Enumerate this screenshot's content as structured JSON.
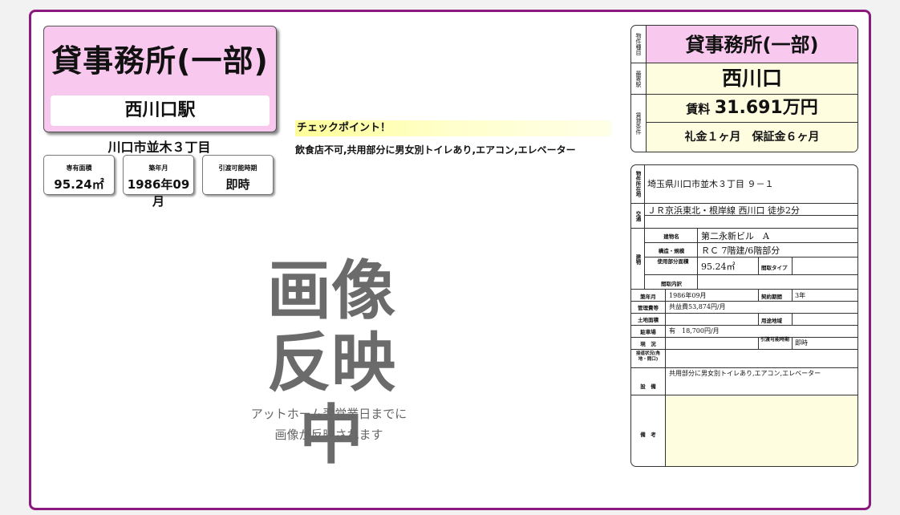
{
  "header": {
    "type": "貸事務所(一部)",
    "station": "西川口駅",
    "address": "川口市並木３丁目"
  },
  "mini_cards": [
    {
      "label": "専有面積",
      "value": "95.24㎡"
    },
    {
      "label": "築年月",
      "value": "1986年09月"
    },
    {
      "label": "引渡可能時期",
      "value": "即時"
    }
  ],
  "checkpoint": {
    "title": "チェックポイント！",
    "text": "飲食店不可,共用部分に男女別トイレあり,エアコン,エレベーター"
  },
  "placeholder": {
    "line1": "画像",
    "line2": "反映中",
    "note1": "アットホーム翌営業日までに",
    "note2": "画像が反映されます"
  },
  "summary": {
    "type_label": "物件種目",
    "type": "貸事務所(一部)",
    "station_label": "最寄駅",
    "station": "西川口",
    "terms_label": "賃貸条件",
    "rent_prefix": "賃料",
    "rent": "31.691万円",
    "deposit": "礼金１ヶ月　保証金６ヶ月"
  },
  "details": {
    "location_label": "物件所在地",
    "location": "埼玉県川口市並木３丁目 ９－１",
    "traffic_label": "交通",
    "traffic": "ＪＲ京浜東北・根岸線 西川口 徒歩2分",
    "building_label": "建物",
    "name_label": "建物名",
    "name": "第二永新ビル　A",
    "structure_label": "構造・規模",
    "structure": "ＲＣ 7階建/6階部分",
    "area_label": "使用部分面積",
    "area": "95.24㎡",
    "layout_type_label": "間取タイプ",
    "layout_detail_label": "間取内訳",
    "built_label": "築年月",
    "built": "1986年09月",
    "contract_label": "契約期間",
    "contract": "3年",
    "mgmt_label": "管理費等",
    "mgmt": "共益費53,874円/月",
    "land_label": "土地面積",
    "zone_label": "用途地域",
    "parking_label": "駐車場",
    "parking": "有　18,700円/月",
    "status_label": "現　況",
    "handover_label": "引渡可能時期",
    "handover": "即時",
    "road_label": "接道状況(角地・間口)",
    "equipment_label": "設　備",
    "equipment": "共用部分に男女別トイレあり,エアコン,エレベーター",
    "remarks_label": "備　考"
  }
}
